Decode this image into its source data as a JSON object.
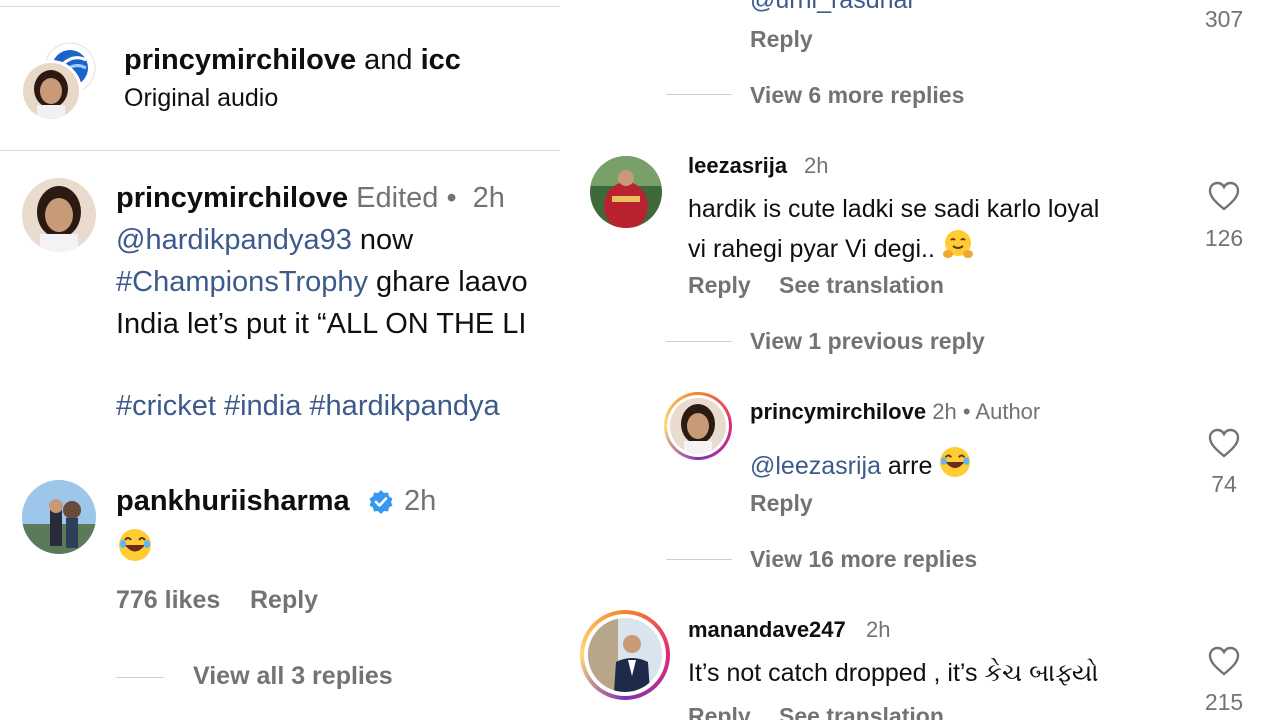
{
  "left": {
    "header": {
      "user": "princymirchilove",
      "and": "and",
      "partner": "icc",
      "audio": "Original audio"
    },
    "post": {
      "username": "princymirchilove",
      "edited": "Edited",
      "dot": "•",
      "time": "2h",
      "mention": "@hardikpandya93",
      "line1_rest": " now",
      "hashtag1": "#ChampionsTrophy",
      "line2_rest": " ghare laavo",
      "line3": "India let’s put it “ALL ON THE LI",
      "tags": "#cricket #india #hardikpandya"
    },
    "comment": {
      "username": "pankhuriisharma",
      "time": "2h",
      "likes": "776 likes",
      "reply": "Reply",
      "view_replies": "View all 3 replies"
    }
  },
  "right": {
    "top": {
      "partial_mention": "@urni_rasdhar",
      "reply": "Reply",
      "count": "307",
      "view_more": "View 6 more replies"
    },
    "c1": {
      "username": "leezasrija",
      "time": "2h",
      "text1": "hardik is cute ladki se sadi karlo loyal",
      "text2": "vi rahegi pyar Vi degi.. ",
      "reply": "Reply",
      "translate": "See translation",
      "count": "126",
      "view_prev": "View 1 previous reply"
    },
    "c2": {
      "username": "princymirchilove",
      "time": "2h",
      "dot": "•",
      "author": "Author",
      "mention": "@leezasrija",
      "text": " arre ",
      "reply": "Reply",
      "count": "74",
      "view_more": "View 16 more replies"
    },
    "c3": {
      "username": "manandave247",
      "time": "2h",
      "text": "It’s not catch dropped , it’s કેચ બાફ્યો",
      "reply": "Reply",
      "translate": "See translation",
      "count": "215"
    }
  },
  "colors": {
    "link": "#3c5a8a",
    "muted": "#737373",
    "verified": "#3897f0",
    "divider": "#dbdbdb"
  },
  "icons": [
    "icc-logo-icon",
    "heart-icon",
    "verified-badge-icon",
    "laughing-emoji-icon",
    "hugging-emoji-icon"
  ]
}
